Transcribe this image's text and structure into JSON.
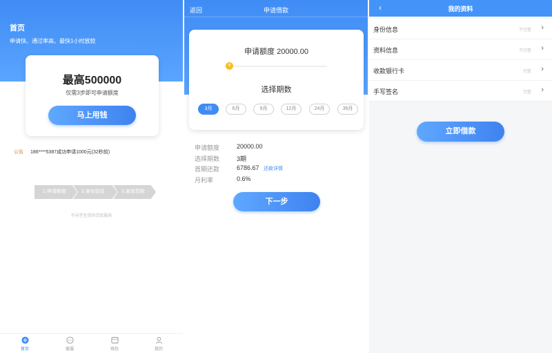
{
  "home": {
    "title": "首页",
    "subtitle": "申请快、通过率高、最快1小时放款",
    "card": {
      "amount": "最高500000",
      "hint": "仅需3步即可申请额度",
      "button": "马上用钱"
    },
    "notice": {
      "label": "公告",
      "text": "186****5387成功申请1000元(32秒前)"
    },
    "steps": [
      "1.申请额度",
      "2.身份验证",
      "3.发放贷款"
    ],
    "footnote": "不向学生提供贷款服务",
    "tabs": [
      {
        "label": "首页",
        "icon": "home-icon",
        "active": true
      },
      {
        "label": "客服",
        "icon": "chat-icon",
        "active": false
      },
      {
        "label": "钱包",
        "icon": "wallet-icon",
        "active": false
      },
      {
        "label": "我的",
        "icon": "user-icon",
        "active": false
      }
    ],
    "accent": "#3f8cf5"
  },
  "apply": {
    "back": "返回",
    "title": "申请借款",
    "amount_text": "申请额度 20000.00",
    "slider_thumb_symbol": "¥",
    "term_title": "选择期数",
    "terms": [
      {
        "label": "3月",
        "active": true
      },
      {
        "label": "6月",
        "active": false
      },
      {
        "label": "9月",
        "active": false
      },
      {
        "label": "12月",
        "active": false
      },
      {
        "label": "24月",
        "active": false
      },
      {
        "label": "36月",
        "active": false
      }
    ],
    "summary": {
      "amount": {
        "label": "申请额度",
        "value": "20000.00"
      },
      "period": {
        "label": "选择期数",
        "value": "3期"
      },
      "first": {
        "label": "首期还款",
        "value": "6786.67",
        "link": "还款详情"
      },
      "rate": {
        "label": "月利率",
        "value": "0.6%"
      }
    },
    "next_button": "下一步"
  },
  "profile": {
    "back": "‹",
    "title": "我的资料",
    "rows": [
      {
        "label": "身份信息",
        "status": "不完整"
      },
      {
        "label": "资料信息",
        "status": "不完整"
      },
      {
        "label": "收款银行卡",
        "status": "完整"
      },
      {
        "label": "手写签名",
        "status": "完整"
      }
    ],
    "arrow": "›",
    "button": "立即借款"
  }
}
